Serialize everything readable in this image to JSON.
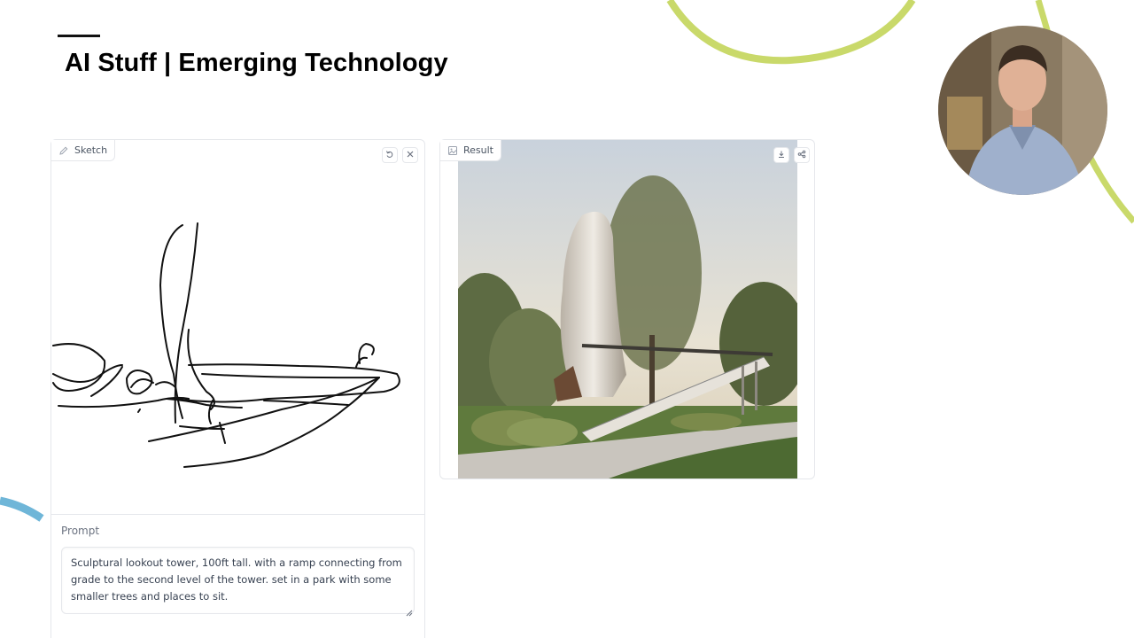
{
  "slide": {
    "title": "AI Stuff | Emerging Technology",
    "accent_green": "#c9d96a",
    "accent_blue": "#6fb6d8"
  },
  "presenter": {
    "photo_icon": "presenter-photo"
  },
  "sketch_panel": {
    "label": "Sketch",
    "label_icon": "pencil-icon",
    "undo_icon": "undo-icon",
    "clear_icon": "close-icon"
  },
  "result_panel": {
    "label": "Result",
    "label_icon": "image-icon",
    "download_icon": "download-icon",
    "share_icon": "share-icon"
  },
  "prompt": {
    "label": "Prompt",
    "value": "Sculptural lookout tower, 100ft tall. with a ramp connecting from grade to the second level of the tower. set in a park with some smaller trees and places to sit."
  }
}
